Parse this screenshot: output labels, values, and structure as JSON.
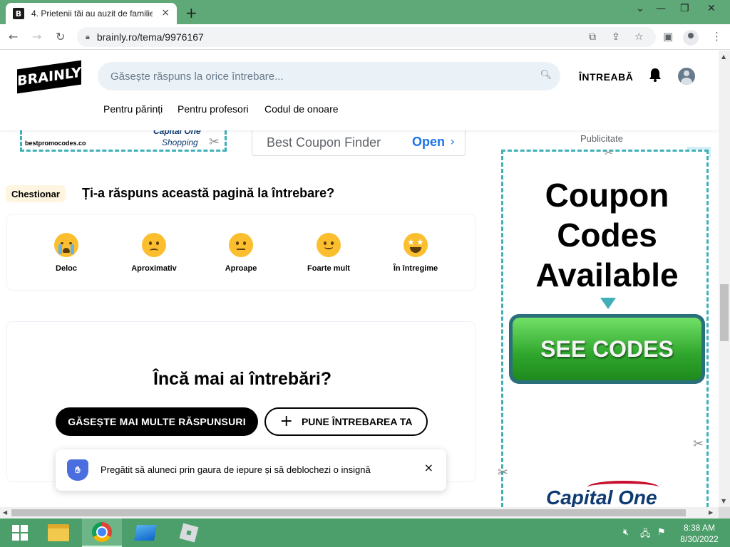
{
  "browser": {
    "tab_title": "4. Prietenii tăi au auzit de familie",
    "favicon_letter": "B",
    "tab_close": "×",
    "new_tab": "+",
    "url": "brainly.ro/tema/9976167",
    "window_controls": {
      "minimize": "—",
      "restore": "❐",
      "close": "✕",
      "tab_list": "⌄"
    }
  },
  "site": {
    "logo_text": "BRAINLY",
    "search_placeholder": "Găsește răspuns la orice întrebare...",
    "ask_label": "ÎNTREABĂ",
    "subnav": [
      "Pentru părinți",
      "Pentru profesori",
      "Codul de onoare"
    ]
  },
  "top_ads": {
    "left_domain": "bestpromocodes.co",
    "left_brand": "Capital One",
    "left_shopping": "Shopping",
    "right_text": "Best Coupon Finder",
    "right_button": "Open"
  },
  "questionnaire": {
    "badge": "Chestionar",
    "title": "Ți-a răspuns această pagină la întrebare?",
    "options": [
      "Deloc",
      "Aproximativ",
      "Aproape",
      "Foarte mult",
      "În întregime"
    ]
  },
  "more_questions": {
    "title": "Încă mai ai întrebări?",
    "find_button": "GĂSEȘTE MAI MULTE RĂSPUNSURI",
    "ask_button": "PUNE ÎNTREBAREA TA"
  },
  "toast": {
    "text": "Pregătit să aluneci prin gaura de iepure și să deblochezi o insignă",
    "close": "×"
  },
  "right_ad": {
    "label": "Publicitate",
    "line1": "Coupon",
    "line2": "Codes",
    "line3": "Available",
    "button": "SEE CODES",
    "brand": "Capital One"
  },
  "taskbar": {
    "time": "8:38 AM",
    "date": "8/30/2022"
  }
}
